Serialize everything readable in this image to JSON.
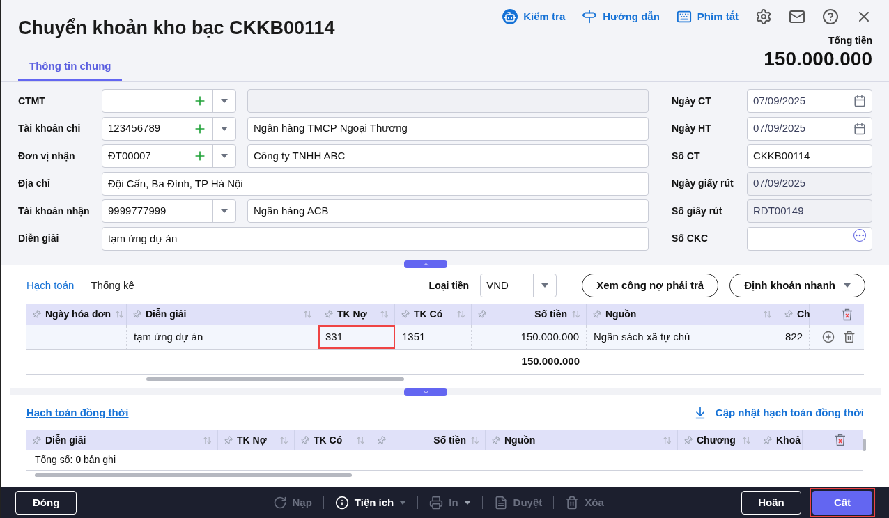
{
  "header": {
    "title": "Chuyển khoản kho bạc CKKB00114",
    "actions": [
      {
        "kind": "check",
        "label": "Kiểm tra"
      },
      {
        "kind": "guide",
        "label": "Hướng dẫn"
      },
      {
        "kind": "shortcut",
        "label": "Phím tắt"
      }
    ],
    "total": {
      "label": "Tổng tiền",
      "value": "150.000.000"
    }
  },
  "tabs": [
    {
      "label": "Thông tin chung",
      "selected": true
    }
  ],
  "form": {
    "left": [
      {
        "label": "CTMT",
        "kind": "combo_add"
      },
      {
        "label": "Tài khoản chi",
        "value": "123456789",
        "kind": "combo_add",
        "description": "Ngân hàng TMCP Ngoại Thương"
      },
      {
        "label": "Đơn vị nhận",
        "value": "ĐT00007",
        "kind": "combo_add",
        "description": "Công ty TNHH ABC"
      },
      {
        "label": "Địa chỉ",
        "value": "Đội Cấn, Ba Đình, TP Hà Nội",
        "kind": "text"
      },
      {
        "label": "Tài khoản nhận",
        "value": "9999777999",
        "kind": "combo",
        "description": "Ngân hàng ACB"
      },
      {
        "label": "Diễn giải",
        "value": "tạm ứng dự án",
        "kind": "text"
      }
    ],
    "right": [
      {
        "label": "Ngày CT",
        "value": "07/09/2025",
        "kind": "date",
        "disabled": false
      },
      {
        "label": "Ngày HT",
        "value": "07/09/2025",
        "kind": "date",
        "disabled": false
      },
      {
        "label": "Số CT",
        "value": "CKKB00114",
        "kind": "text",
        "disabled": false
      },
      {
        "label": "Ngày giấy rút",
        "value": "07/09/2025",
        "kind": "text",
        "disabled": true
      },
      {
        "label": "Số giấy rút",
        "value": "RDT00149",
        "kind": "text",
        "disabled": true
      },
      {
        "label": "Số CKC",
        "kind": "lookup",
        "disabled": false
      }
    ]
  },
  "detail": {
    "tabs": [
      {
        "label": "Hạch toán",
        "selected": true
      },
      {
        "label": "Thống kê",
        "selected": false
      }
    ],
    "currency": {
      "label": "Loại tiền",
      "value": "VND"
    },
    "buttons": [
      {
        "label": "Xem công nợ phải trả",
        "menu": false
      },
      {
        "label": "Định khoản nhanh",
        "menu": true
      }
    ],
    "table": {
      "columns": [
        {
          "label": "Ngày hóa đơn",
          "kind": "text"
        },
        {
          "label": "Diễn giải",
          "kind": "text"
        },
        {
          "label": "TK Nợ",
          "kind": "text"
        },
        {
          "label": "TK Có",
          "kind": "text"
        },
        {
          "label": "Số tiền",
          "kind": "amount"
        },
        {
          "label": "Nguồn",
          "kind": "text"
        },
        {
          "label": "Ch",
          "kind": "text"
        }
      ],
      "rows": [
        {
          "cells": [
            {
              "highlighted": false
            },
            {
              "text": "tạm ứng dự án",
              "highlighted": false
            },
            {
              "text": "331",
              "highlighted": true
            },
            {
              "text": "1351",
              "highlighted": false
            },
            {
              "text": "150.000.000",
              "highlighted": false
            },
            {
              "text": "Ngân sách xã tự chủ",
              "highlighted": false
            },
            {
              "text": "822",
              "highlighted": false
            }
          ]
        }
      ],
      "total": "150.000.000"
    }
  },
  "simultaneous": {
    "title": "Hạch toán đồng thời",
    "update": "Cập nhật hạch toán đồng thời",
    "columns": [
      {
        "label": "Diễn giải",
        "kind": "text"
      },
      {
        "label": "TK Nợ",
        "kind": "text"
      },
      {
        "label": "TK Có",
        "kind": "text"
      },
      {
        "label": "Số tiền",
        "kind": "amount"
      },
      {
        "label": "Nguồn",
        "kind": "text"
      },
      {
        "label": "Chương",
        "kind": "text"
      },
      {
        "label": "Khoả",
        "kind": "text"
      }
    ],
    "summary": "Tổng số: **0** bản ghi"
  },
  "footer": {
    "close": "Đóng",
    "actions": [
      {
        "kind": "reload",
        "label": "Nạp",
        "disabled": true,
        "menu": false
      },
      {
        "kind": "utility",
        "label": "Tiện ích",
        "disabled": false,
        "menu": true
      },
      {
        "kind": "print",
        "label": "In",
        "disabled": true,
        "menu": true
      },
      {
        "kind": "approve",
        "label": "Duyệt",
        "disabled": true,
        "menu": false
      },
      {
        "kind": "delete",
        "label": "Xóa",
        "disabled": true,
        "menu": false
      }
    ],
    "buttons": [
      {
        "label": "Hoãn",
        "primary": false,
        "highlighted": false
      },
      {
        "label": "Cất",
        "primary": true,
        "highlighted": true
      }
    ]
  }
}
